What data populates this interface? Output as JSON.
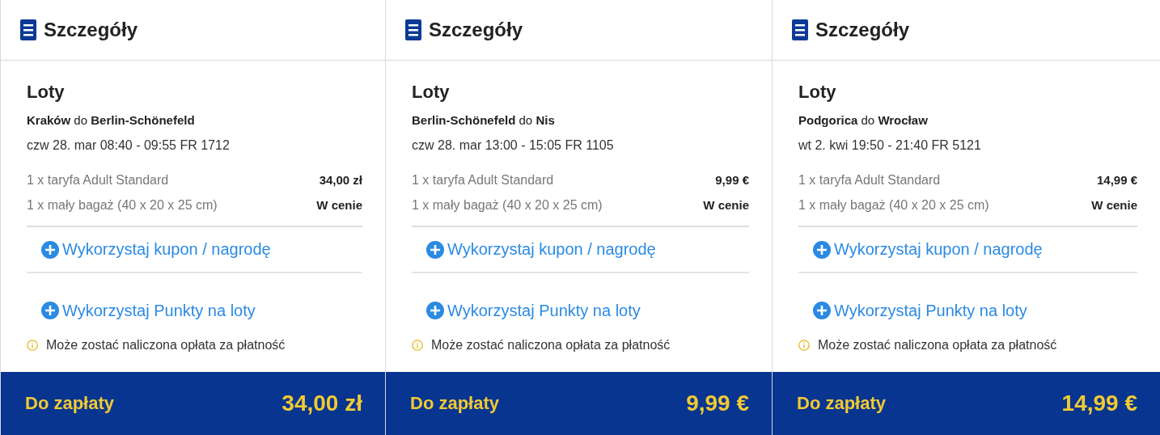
{
  "panels": [
    {
      "title": "Szczegóły",
      "section": "Loty",
      "route": "**Kraków** do **Berlin-Schönefeld**",
      "flight": "czw 28. mar 08:40 - 09:55 FR 1712",
      "items": [
        {
          "label": "1 x taryfa Adult Standard",
          "value": "34,00 zł"
        },
        {
          "label": "1 x mały bagaż (40 x 20 x 25 cm)",
          "value": "W cenie"
        }
      ],
      "coupon_link": "Wykorzystaj kupon / nagrodę",
      "points_link": "Wykorzystaj Punkty na loty",
      "notice": "Może zostać naliczona opłata za płatność",
      "total_label": "Do zapłaty",
      "total": "34,00 zł"
    },
    {
      "title": "Szczegóły",
      "section": "Loty",
      "route": "**Berlin-Schönefeld** do **Nis**",
      "flight": "czw 28. mar 13:00 - 15:05 FR 1105",
      "items": [
        {
          "label": "1 x taryfa Adult Standard",
          "value": "9,99 €"
        },
        {
          "label": "1 x mały bagaż (40 x 20 x 25 cm)",
          "value": "W cenie"
        }
      ],
      "coupon_link": "Wykorzystaj kupon / nagrodę",
      "points_link": "Wykorzystaj Punkty na loty",
      "notice": "Może zostać naliczona opłata za płatność",
      "total_label": "Do zapłaty",
      "total": "9,99 €"
    },
    {
      "title": "Szczegóły",
      "section": "Loty",
      "route": "**Podgorica** do **Wrocław**",
      "flight": "wt 2. kwi 19:50 - 21:40 FR 5121",
      "items": [
        {
          "label": "1 x taryfa Adult Standard",
          "value": "14,99 €"
        },
        {
          "label": "1 x mały bagaż (40 x 20 x 25 cm)",
          "value": "W cenie"
        }
      ],
      "coupon_link": "Wykorzystaj kupon / nagrodę",
      "points_link": "Wykorzystaj Punkty na loty",
      "notice": "Może zostać naliczona opłata za płatność",
      "total_label": "Do zapłaty",
      "total": "14,99 €"
    }
  ]
}
